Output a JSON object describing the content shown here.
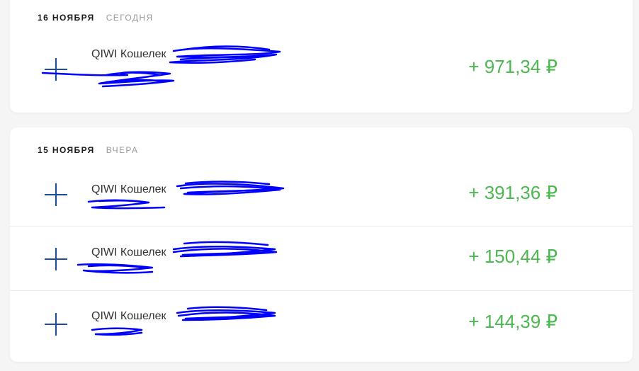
{
  "groups": [
    {
      "date": "16 НОЯБРЯ",
      "relative": "СЕГОДНЯ",
      "transactions": [
        {
          "title": "QIWI Кошелек",
          "amount": "+ 971,34 ₽",
          "icon": "plus-icon"
        }
      ]
    },
    {
      "date": "15 НОЯБРЯ",
      "relative": "ВЧЕРА",
      "transactions": [
        {
          "title": "QIWI Кошелек",
          "amount": "+ 391,36 ₽",
          "icon": "plus-icon"
        },
        {
          "title": "QIWI Кошелек",
          "amount": "+ 150,44 ₽",
          "icon": "plus-icon"
        },
        {
          "title": "QIWI Кошелек",
          "amount": "+ 144,39 ₽",
          "icon": "plus-icon"
        }
      ]
    }
  ],
  "colors": {
    "amount": "#4cb850",
    "icon": "#1a4f9c",
    "redaction": "#0000ff"
  }
}
